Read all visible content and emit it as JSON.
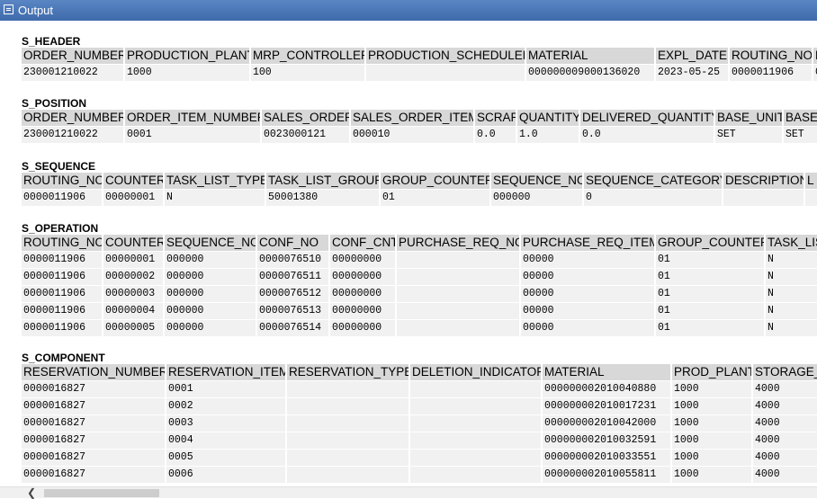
{
  "window": {
    "title": "Output"
  },
  "sections": [
    {
      "id": "s-header",
      "title": "S_HEADER",
      "columns": [
        "ORDER_NUMBER",
        "PRODUCTION_PLANT",
        "MRP_CONTROLLER",
        "PRODUCTION_SCHEDULER",
        "MATERIAL",
        "EXPL_DATE",
        "ROUTING_NO",
        "R"
      ],
      "widths": [
        114,
        140,
        128,
        178,
        144,
        82,
        93,
        20
      ],
      "rows": [
        [
          "230001210022",
          "1000",
          "100",
          "",
          "000000009000136020",
          "2023-05-25",
          "0000011906",
          "0"
        ]
      ]
    },
    {
      "id": "s-position",
      "title": "S_POSITION",
      "columns": [
        "ORDER_NUMBER",
        "ORDER_ITEM_NUMBER",
        "SALES_ORDER",
        "SALES_ORDER_ITEM",
        "SCRAP",
        "QUANTITY",
        "DELIVERED_QUANTITY",
        "BASE_UNIT",
        "BASE_"
      ],
      "widths": [
        114,
        152,
        99,
        138,
        47,
        70,
        150,
        76,
        60
      ],
      "rows": [
        [
          "230001210022",
          "0001",
          "0023000121",
          "000010",
          "0.0",
          "1.0",
          "0.0",
          "SET",
          "SET"
        ]
      ]
    },
    {
      "id": "s-sequence",
      "title": "S_SEQUENCE",
      "columns": [
        "ROUTING_NO",
        "COUNTER",
        "TASK_LIST_TYPE",
        "TASK_LIST_GROUP",
        "GROUP_COUNTER",
        "SEQUENCE_NO",
        "SEQUENCE_CATEGORY",
        "DESCRIPTION",
        "L"
      ],
      "widths": [
        90,
        68,
        113,
        127,
        123,
        103,
        155,
        91,
        20
      ],
      "rows": [
        [
          "0000011906",
          "00000001",
          "N",
          "50001380",
          "01",
          "000000",
          "0",
          "",
          ""
        ]
      ]
    },
    {
      "id": "s-operation",
      "title": "S_OPERATION",
      "columns": [
        "ROUTING_NO",
        "COUNTER",
        "SEQUENCE_NO",
        "CONF_NO",
        "CONF_CNT",
        "PURCHASE_REQ_NO",
        "PURCHASE_REQ_ITEM",
        "GROUP_COUNTER",
        "TASK_LIS"
      ],
      "widths": [
        90,
        68,
        103,
        81,
        74,
        138,
        150,
        122,
        70
      ],
      "rows": [
        [
          "0000011906",
          "00000001",
          "000000",
          "0000076510",
          "00000000",
          "",
          "00000",
          "01",
          "N"
        ],
        [
          "0000011906",
          "00000002",
          "000000",
          "0000076511",
          "00000000",
          "",
          "00000",
          "01",
          "N"
        ],
        [
          "0000011906",
          "00000003",
          "000000",
          "0000076512",
          "00000000",
          "",
          "00000",
          "01",
          "N"
        ],
        [
          "0000011906",
          "00000004",
          "000000",
          "0000076513",
          "00000000",
          "",
          "00000",
          "01",
          "N"
        ],
        [
          "0000011906",
          "00000005",
          "000000",
          "0000076514",
          "00000000",
          "",
          "00000",
          "01",
          "N"
        ]
      ]
    },
    {
      "id": "s-component",
      "title": "S_COMPONENT",
      "columns": [
        "RESERVATION_NUMBER",
        "RESERVATION_ITEM",
        "RESERVATION_TYPE",
        "DELETION_INDICATOR",
        "MATERIAL",
        "PROD_PLANT",
        "STORAGE_"
      ],
      "widths": [
        160,
        134,
        137,
        147,
        144,
        90,
        80
      ],
      "rows": [
        [
          "0000016827",
          "0001",
          "",
          "",
          "000000002010040880",
          "1000",
          "4000"
        ],
        [
          "0000016827",
          "0002",
          "",
          "",
          "000000002010017231",
          "1000",
          "4000"
        ],
        [
          "0000016827",
          "0003",
          "",
          "",
          "000000002010042000",
          "1000",
          "4000"
        ],
        [
          "0000016827",
          "0004",
          "",
          "",
          "000000002010032591",
          "1000",
          "4000"
        ],
        [
          "0000016827",
          "0005",
          "",
          "",
          "000000002010033551",
          "1000",
          "4000"
        ],
        [
          "0000016827",
          "0006",
          "",
          "",
          "000000002010055811",
          "1000",
          "4000"
        ]
      ]
    }
  ]
}
